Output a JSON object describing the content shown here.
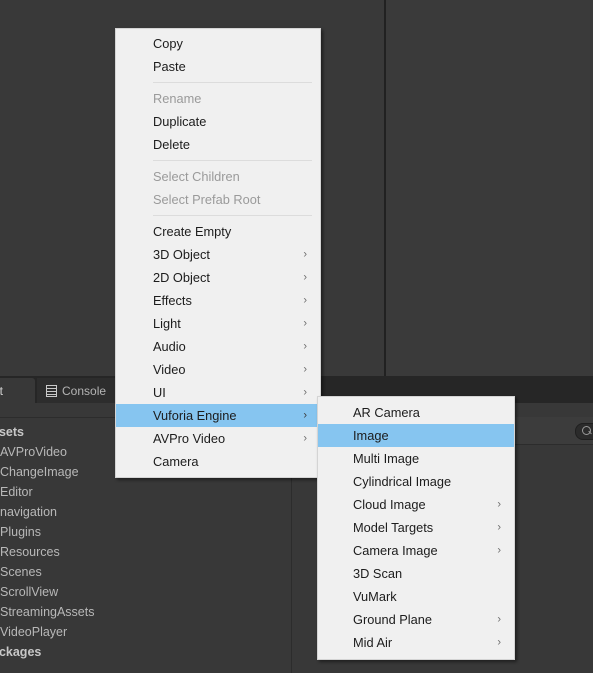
{
  "editor": {
    "panel_tabs": [
      {
        "label": "ect",
        "icon": "",
        "active": true,
        "name": "tab-project"
      },
      {
        "label": "Console",
        "icon": "console-icon",
        "active": false,
        "name": "tab-console"
      }
    ],
    "search": {
      "icon": "search-icon",
      "value": ""
    },
    "file_tree": [
      {
        "label": "ssets",
        "root": true
      },
      {
        "label": "AVProVideo",
        "root": false
      },
      {
        "label": "ChangeImage",
        "root": false
      },
      {
        "label": "Editor",
        "root": false
      },
      {
        "label": "navigation",
        "root": false
      },
      {
        "label": "Plugins",
        "root": false
      },
      {
        "label": "Resources",
        "root": false
      },
      {
        "label": "Scenes",
        "root": false
      },
      {
        "label": "ScrollView",
        "root": false
      },
      {
        "label": "StreamingAssets",
        "root": false
      },
      {
        "label": "VideoPlayer",
        "root": false
      },
      {
        "label": "ackages",
        "root": true
      }
    ]
  },
  "context_menu": {
    "items": [
      {
        "label": "Copy",
        "disabled": false,
        "submenu": false,
        "highlight": false
      },
      {
        "label": "Paste",
        "disabled": false,
        "submenu": false,
        "highlight": false
      },
      {
        "separator": true
      },
      {
        "label": "Rename",
        "disabled": true,
        "submenu": false,
        "highlight": false
      },
      {
        "label": "Duplicate",
        "disabled": false,
        "submenu": false,
        "highlight": false
      },
      {
        "label": "Delete",
        "disabled": false,
        "submenu": false,
        "highlight": false
      },
      {
        "separator": true
      },
      {
        "label": "Select Children",
        "disabled": true,
        "submenu": false,
        "highlight": false
      },
      {
        "label": "Select Prefab Root",
        "disabled": true,
        "submenu": false,
        "highlight": false
      },
      {
        "separator": true
      },
      {
        "label": "Create Empty",
        "disabled": false,
        "submenu": false,
        "highlight": false
      },
      {
        "label": "3D Object",
        "disabled": false,
        "submenu": true,
        "highlight": false
      },
      {
        "label": "2D Object",
        "disabled": false,
        "submenu": true,
        "highlight": false
      },
      {
        "label": "Effects",
        "disabled": false,
        "submenu": true,
        "highlight": false
      },
      {
        "label": "Light",
        "disabled": false,
        "submenu": true,
        "highlight": false
      },
      {
        "label": "Audio",
        "disabled": false,
        "submenu": true,
        "highlight": false
      },
      {
        "label": "Video",
        "disabled": false,
        "submenu": true,
        "highlight": false
      },
      {
        "label": "UI",
        "disabled": false,
        "submenu": true,
        "highlight": false
      },
      {
        "label": "Vuforia Engine",
        "disabled": false,
        "submenu": true,
        "highlight": true
      },
      {
        "label": "AVPro Video",
        "disabled": false,
        "submenu": true,
        "highlight": false
      },
      {
        "label": "Camera",
        "disabled": false,
        "submenu": false,
        "highlight": false
      }
    ]
  },
  "submenu": {
    "parent": "Vuforia Engine",
    "items": [
      {
        "label": "AR Camera",
        "submenu": false,
        "highlight": false
      },
      {
        "label": "Image",
        "submenu": false,
        "highlight": true
      },
      {
        "label": "Multi Image",
        "submenu": false,
        "highlight": false
      },
      {
        "label": "Cylindrical Image",
        "submenu": false,
        "highlight": false
      },
      {
        "label": "Cloud Image",
        "submenu": true,
        "highlight": false
      },
      {
        "label": "Model Targets",
        "submenu": true,
        "highlight": false
      },
      {
        "label": "Camera Image",
        "submenu": true,
        "highlight": false
      },
      {
        "label": "3D Scan",
        "submenu": false,
        "highlight": false
      },
      {
        "label": "VuMark",
        "submenu": false,
        "highlight": false
      },
      {
        "label": "Ground Plane",
        "submenu": true,
        "highlight": false
      },
      {
        "label": "Mid Air",
        "submenu": true,
        "highlight": false
      }
    ]
  },
  "colors": {
    "menu_background": "#f0f0f0",
    "menu_highlight": "#86c5f0",
    "editor_background": "#383838",
    "tab_strip": "#262626",
    "disabled_text": "#9a9a9a",
    "tree_text": "#b8b8b8"
  },
  "arrow_glyph": "›"
}
